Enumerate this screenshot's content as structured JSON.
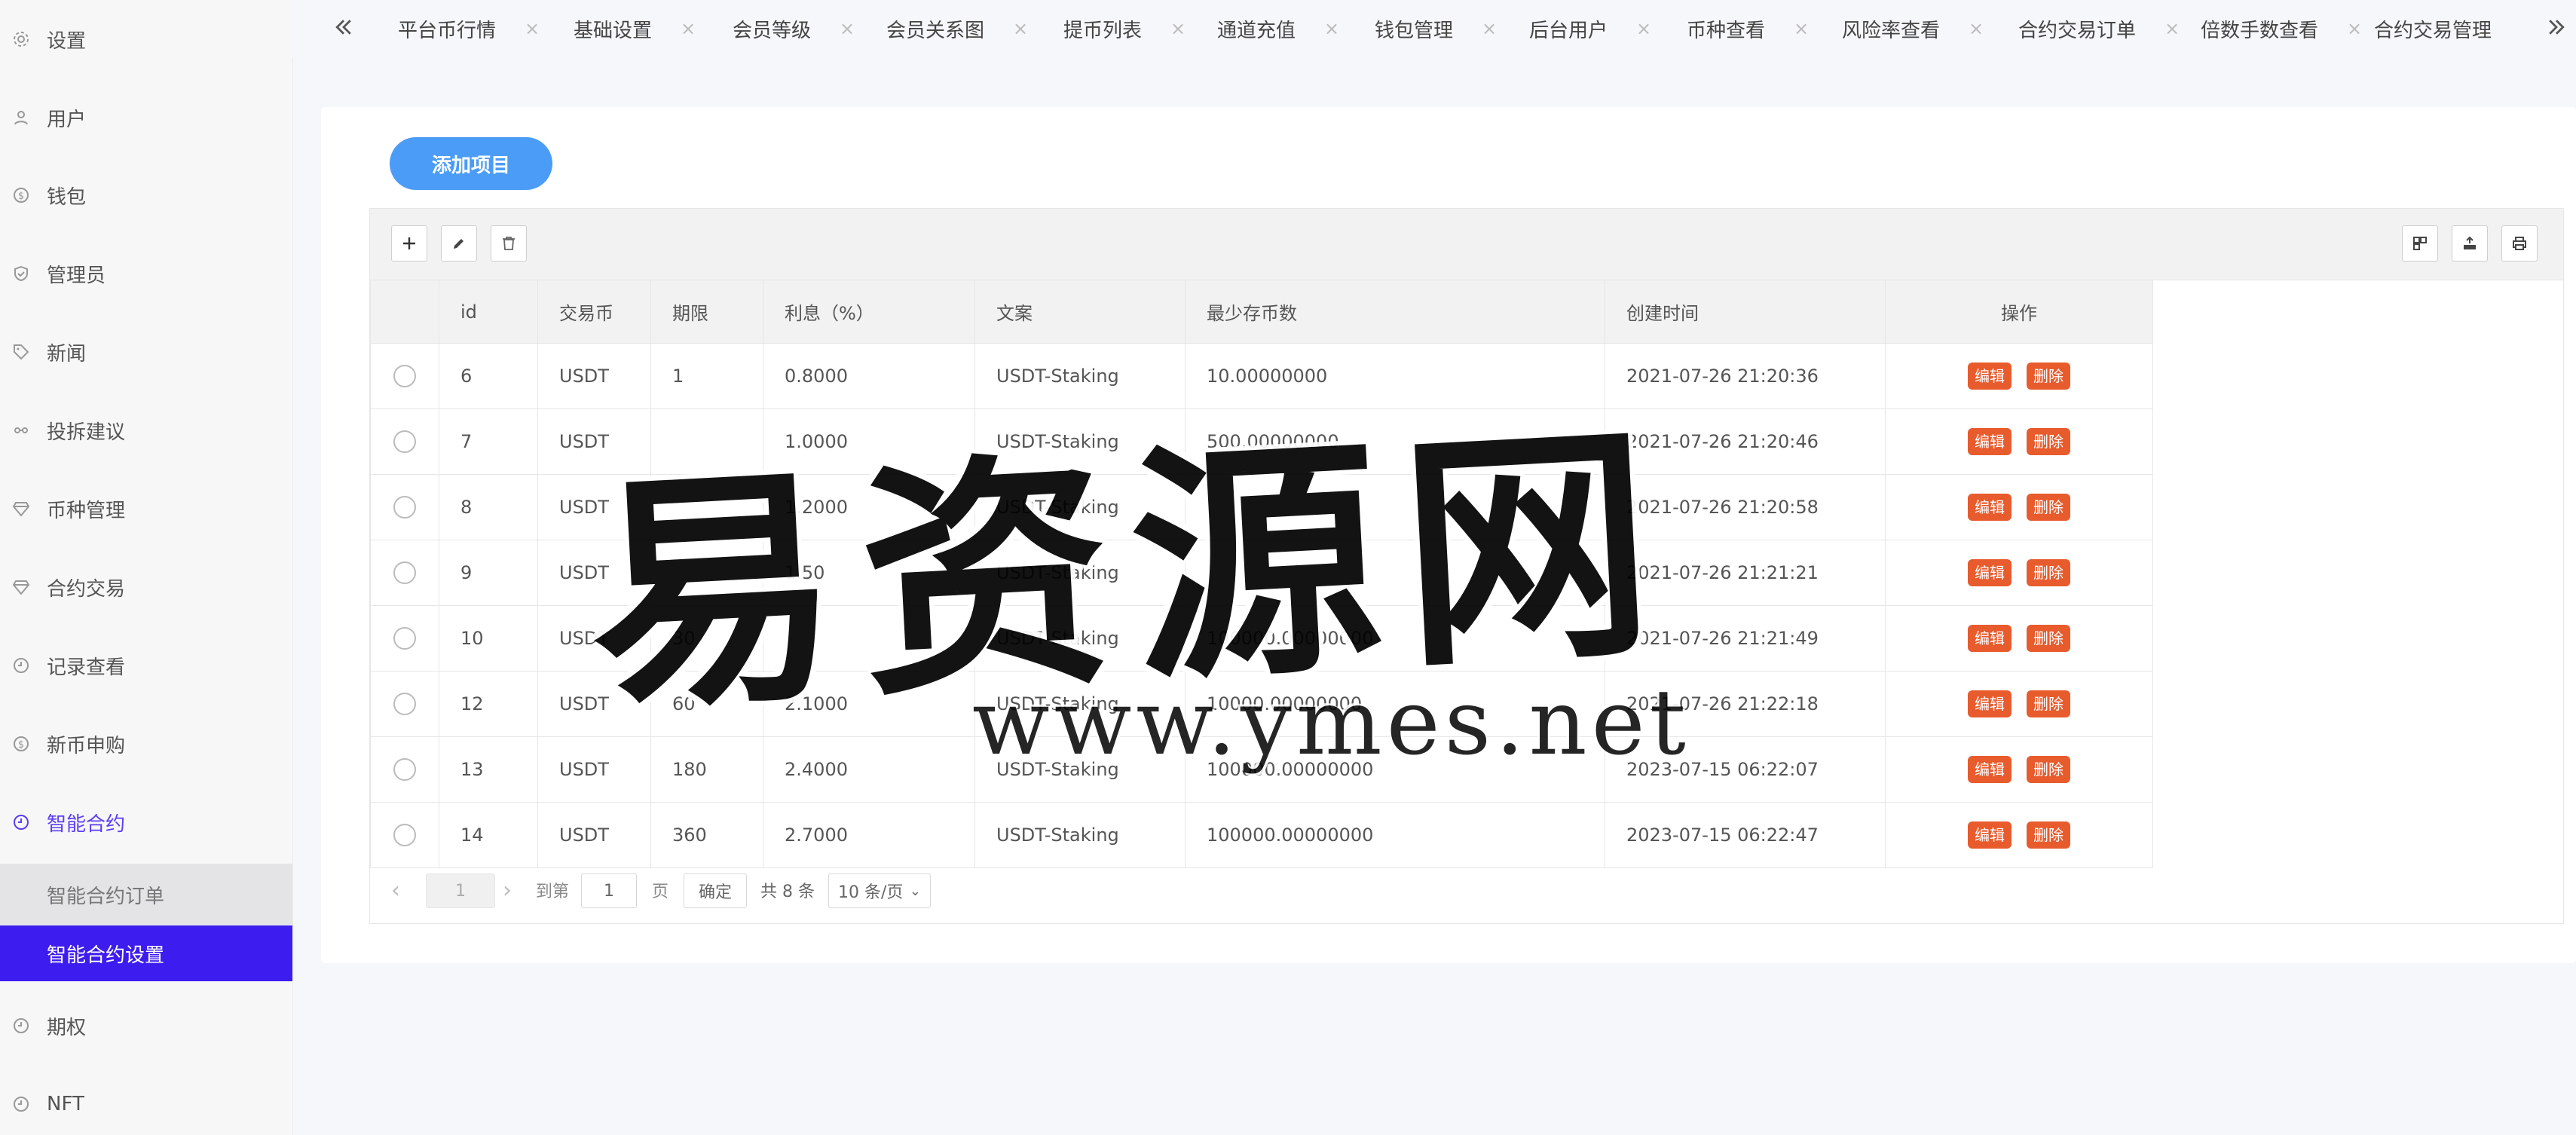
{
  "sidebar": {
    "items": [
      {
        "label": "设置",
        "icon": "gear-icon"
      },
      {
        "label": "用户",
        "icon": "user-icon"
      },
      {
        "label": "钱包",
        "icon": "dollar-circle-icon"
      },
      {
        "label": "管理员",
        "icon": "shield-icon"
      },
      {
        "label": "新闻",
        "icon": "tag-icon"
      },
      {
        "label": "投拆建议",
        "icon": "link-icon"
      },
      {
        "label": "币种管理",
        "icon": "diamond-icon"
      },
      {
        "label": "合约交易",
        "icon": "diamond-icon"
      },
      {
        "label": "记录查看",
        "icon": "clock-icon"
      },
      {
        "label": "新币申购",
        "icon": "dollar-circle-icon"
      },
      {
        "label": "智能合约",
        "icon": "clock-icon"
      },
      {
        "label": "期权",
        "icon": "clock-icon"
      },
      {
        "label": "NFT",
        "icon": "clock-icon"
      }
    ],
    "submenu": {
      "orders": "智能合约订单",
      "settings": "智能合约设置"
    }
  },
  "tabs": [
    "平台币行情",
    "基础设置",
    "会员等级",
    "会员关系图",
    "提币列表",
    "通道充值",
    "钱包管理",
    "后台用户",
    "币种查看",
    "风险率查看",
    "合约交易订单",
    "倍数手数查看",
    "合约交易管理"
  ],
  "tab_close_glyph": "×",
  "main": {
    "add_button": "添加项目",
    "table": {
      "headers": {
        "id": "id",
        "coin": "交易币",
        "period": "期限",
        "interest": "利息（%）",
        "copy": "文案",
        "min_deposit": "最少存币数",
        "created": "创建时间",
        "ops": "操作"
      },
      "rows": [
        {
          "id": "6",
          "coin": "USDT",
          "period": "1",
          "interest": "0.8000",
          "copy": "USDT-Staking",
          "min_deposit": "10.00000000",
          "created": "2021-07-26 21:20:36"
        },
        {
          "id": "7",
          "coin": "USDT",
          "period": "",
          "interest": "1.0000",
          "copy": "USDT-Staking",
          "min_deposit": "500.00000000",
          "created": "2021-07-26 21:20:46"
        },
        {
          "id": "8",
          "coin": "USDT",
          "period": "",
          "interest": "1.2000",
          "copy": "USDT-Staking",
          "min_deposit": "",
          "created": "2021-07-26 21:20:58"
        },
        {
          "id": "9",
          "coin": "USDT",
          "period": "",
          "interest": "1.50",
          "copy": "USDT-Staking",
          "min_deposit": "",
          "created": "2021-07-26 21:21:21"
        },
        {
          "id": "10",
          "coin": "USDT",
          "period": "30",
          "interest": "",
          "copy": "USDT-Staking",
          "min_deposit": "100000.00000000",
          "created": "2021-07-26 21:21:49"
        },
        {
          "id": "12",
          "coin": "USDT",
          "period": "60",
          "interest": "2.1000",
          "copy": "USDT-Staking",
          "min_deposit": "10000.00000000",
          "created": "2021-07-26 21:22:18"
        },
        {
          "id": "13",
          "coin": "USDT",
          "period": "180",
          "interest": "2.4000",
          "copy": "USDT-Staking",
          "min_deposit": "100000.00000000",
          "created": "2023-07-15 06:22:07"
        },
        {
          "id": "14",
          "coin": "USDT",
          "period": "360",
          "interest": "2.7000",
          "copy": "USDT-Staking",
          "min_deposit": "100000.00000000",
          "created": "2023-07-15 06:22:47"
        }
      ],
      "edit_label": "编辑",
      "delete_label": "删除"
    },
    "pagination": {
      "current_page": "1",
      "goto_label": "到第",
      "goto_value": "1",
      "page_unit": "页",
      "confirm_label": "确定",
      "total_label": "共 8 条",
      "page_size": "10 条/页"
    }
  },
  "watermark": {
    "main": "易资源网",
    "url": "www.ymes.net"
  },
  "colors": {
    "active_menu_bg": "#3d1cf0",
    "add_button": "#4b9cf7",
    "op_button": "#e85b2d"
  }
}
